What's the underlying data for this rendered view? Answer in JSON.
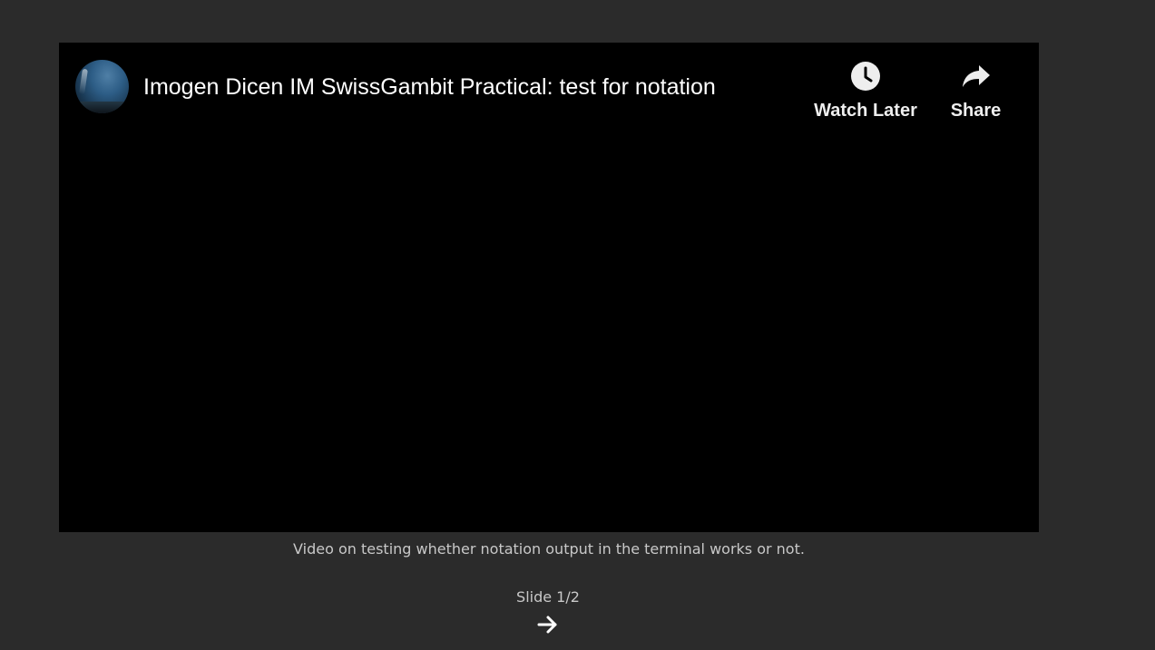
{
  "video": {
    "title": "Imogen Dicen IM SwissGambit Practical: test for notation",
    "avatar_icon": "channel-avatar",
    "actions": {
      "watch_later": {
        "label": "Watch Later",
        "icon": "clock-icon"
      },
      "share": {
        "label": "Share",
        "icon": "share-arrow-icon"
      }
    }
  },
  "caption": "Video on testing whether notation output in the terminal works or not.",
  "slideshow": {
    "counter": "Slide 1/2",
    "next_icon": "arrow-right-icon"
  },
  "colors": {
    "page_background": "#2b2b2b",
    "player_background": "#000000",
    "title_text": "#ffffff",
    "caption_text": "#c8c8c8"
  }
}
